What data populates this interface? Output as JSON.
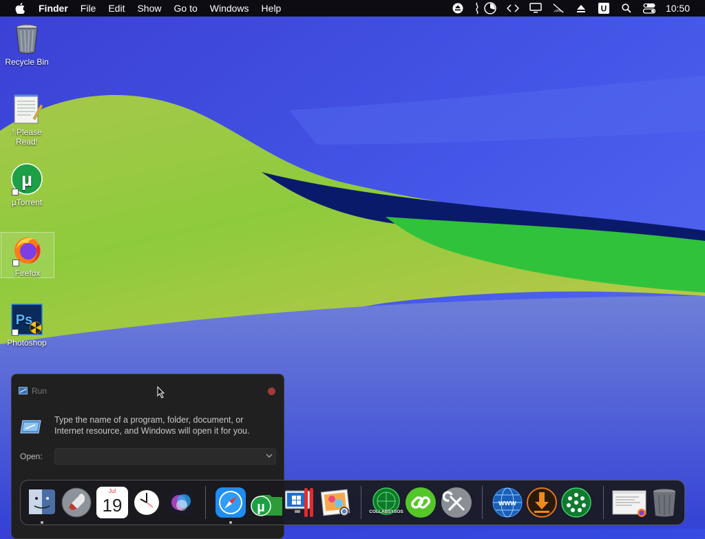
{
  "menubar": {
    "app_name": "Finder",
    "items": [
      "File",
      "Edit",
      "Show",
      "Go to",
      "Windows",
      "Help"
    ],
    "clock": "10:50",
    "status_icons": [
      "eject-icon",
      "audio-wave-icon",
      "pie-chart-icon",
      "code-icon",
      "display-icon",
      "muted-icon",
      "upload-icon",
      "u-badge-icon",
      "search-icon",
      "control-center-icon"
    ]
  },
  "desktop": {
    "icons": [
      {
        "label": "Recycle Bin",
        "icon": "recycle-bin-icon"
      },
      {
        "label": "! Please Read!",
        "icon": "notepad-icon"
      },
      {
        "label": "µTorrent",
        "icon": "utorrent-icon"
      },
      {
        "label": "Firefox",
        "icon": "firefox-icon"
      },
      {
        "label": "Photoshop",
        "icon": "photoshop-icon"
      }
    ]
  },
  "run_dialog": {
    "title": "Run",
    "description": "Type the name of a program, folder, document, or Internet resource, and Windows will open it for you.",
    "open_label": "Open:",
    "open_value": ""
  },
  "dock": {
    "calendar_month": "Jul",
    "calendar_day": "19",
    "apps_badge": "COLLABSYSOS",
    "items": [
      "finder-icon",
      "launchpad-icon",
      "calendar-icon",
      "clock-icon",
      "siri-icon",
      "safari-icon",
      "utorrent-folder-icon",
      "parallels-windows-icon",
      "preview-icon",
      "collabsysos-icon",
      "link-icon",
      "system-tools-icon",
      "web-browser-icon",
      "downloads-icon",
      "network-icon",
      "window-thumbnail-icon",
      "trash-icon"
    ]
  },
  "colors": {
    "wallpaper_blue": "#3a46dc",
    "hill_green": "#7fd23c",
    "dialog_bg": "#202020",
    "menubar_bg": "#0c0c12"
  }
}
